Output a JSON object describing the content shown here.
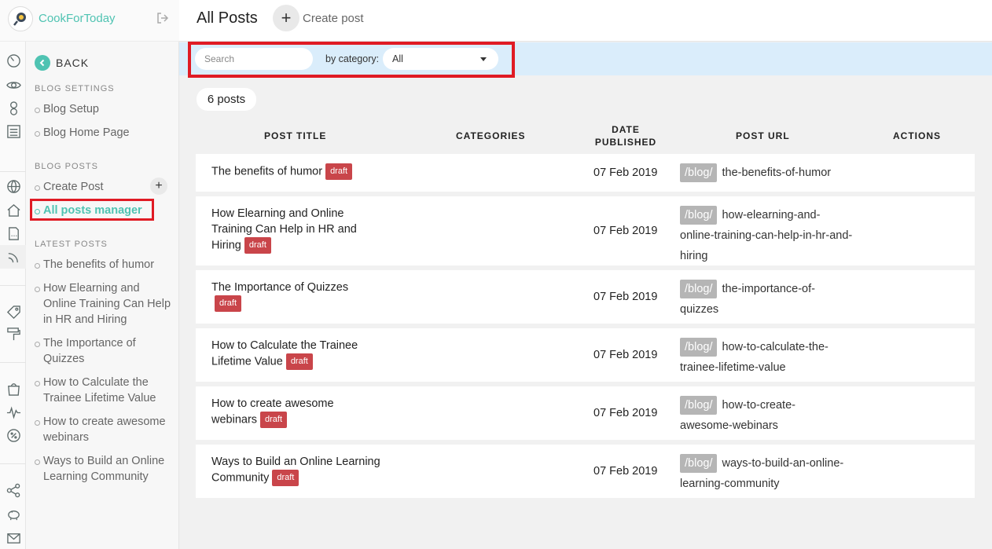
{
  "app": {
    "name": "CookForToday"
  },
  "header": {
    "title": "All Posts",
    "create_label": "Create post",
    "create_icon": "+"
  },
  "menu": {
    "back_label": "BACK",
    "blog_settings": {
      "title": "BLOG SETTINGS",
      "items": [
        {
          "label": "Blog Setup"
        },
        {
          "label": "Blog Home Page"
        }
      ]
    },
    "blog_posts": {
      "title": "BLOG POSTS",
      "items": [
        {
          "label": "Create Post"
        },
        {
          "label": "All posts manager"
        }
      ]
    },
    "latest_posts": {
      "title": "LATEST POSTS",
      "items": [
        {
          "label": "The benefits of humor"
        },
        {
          "label": "How Elearning and Online Training Can Help in HR and Hiring"
        },
        {
          "label": "The Importance of Quizzes"
        },
        {
          "label": "How to Calculate the Trainee Lifetime Value"
        },
        {
          "label": "How to create awesome webinars"
        },
        {
          "label": "Ways to Build an Online Learning Community"
        }
      ]
    }
  },
  "filters": {
    "search_placeholder": "Search",
    "category_label": "by category:",
    "category_value": "All"
  },
  "count": "6 posts",
  "table": {
    "headers": {
      "title": "POST TITLE",
      "categories": "CATEGORIES",
      "date_l1": "DATE",
      "date_l2": "PUBLISHED",
      "url": "POST URL",
      "actions": "ACTIONS"
    },
    "url_prefix": "/blog/",
    "rows": [
      {
        "title": "The benefits of humor",
        "status": "draft",
        "date": "07 Feb 2019",
        "slug": "the-benefits-of-humor"
      },
      {
        "title": "How Elearning and Online Training Can Help in HR and Hiring",
        "status": "draft",
        "date": "07 Feb 2019",
        "slug": "how-elearning-and-online-training-can-help-in-hr-and-hiring"
      },
      {
        "title": "The Importance of Quizzes",
        "status": "draft",
        "date": "07 Feb 2019",
        "slug": "the-importance-of-quizzes"
      },
      {
        "title": "How to Calculate the Trainee Lifetime Value",
        "status": "draft",
        "date": "07 Feb 2019",
        "slug": "how-to-calculate-the-trainee-lifetime-value"
      },
      {
        "title": "How to create awesome webinars",
        "status": "draft",
        "date": "07 Feb 2019",
        "slug": "how-to-create-awesome-webinars"
      },
      {
        "title": "Ways to Build an Online Learning Community",
        "status": "draft",
        "date": "07 Feb 2019",
        "slug": "ways-to-build-an-online-learning-community"
      }
    ]
  },
  "colors": {
    "accent": "#4fc3b2",
    "draft_badge": "#c9454a",
    "highlight": "#e01b24",
    "filter_bar": "#daedfb"
  }
}
